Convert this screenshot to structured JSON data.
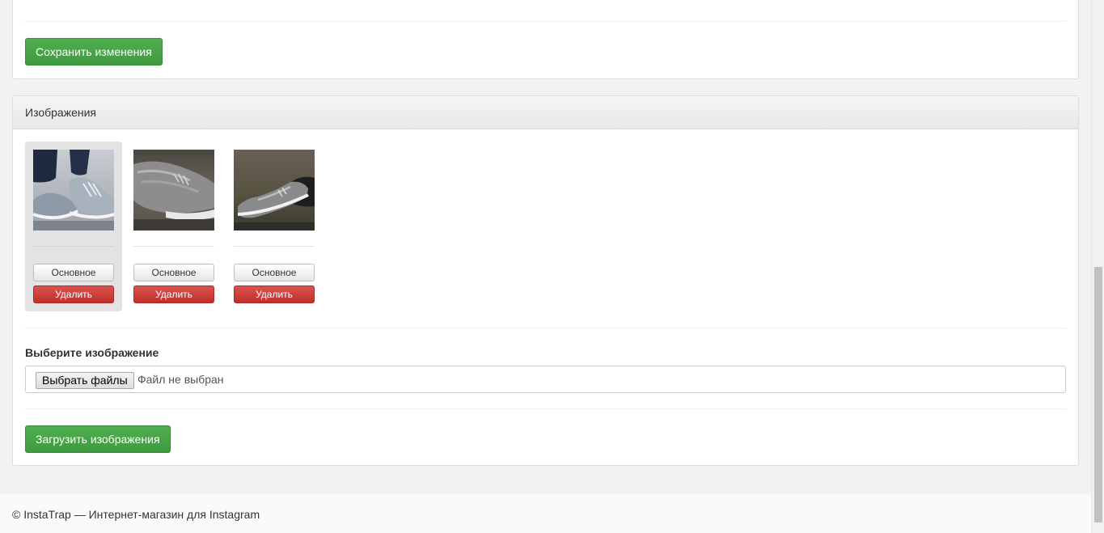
{
  "top_panel": {
    "save_label": "Сохранить изменения"
  },
  "images_panel": {
    "title": "Изображения",
    "images": [
      {
        "icon": "sneaker-on-foot-photo",
        "main_label": "Основное",
        "delete_label": "Удалить",
        "active": true
      },
      {
        "icon": "sneaker-on-ground-photo",
        "main_label": "Основное",
        "delete_label": "Удалить",
        "active": false
      },
      {
        "icon": "sneaker-side-photo",
        "main_label": "Основное",
        "delete_label": "Удалить",
        "active": false
      }
    ],
    "file_label": "Выберите изображение",
    "file_button": "Выбрать файлы",
    "file_status": "Файл не выбран",
    "upload_label": "Загрузить изображения"
  },
  "footer": {
    "text": "© InstaTrap — Интернет-магазин для Instagram"
  },
  "colors": {
    "success": "#449d44",
    "danger": "#d9534f"
  }
}
